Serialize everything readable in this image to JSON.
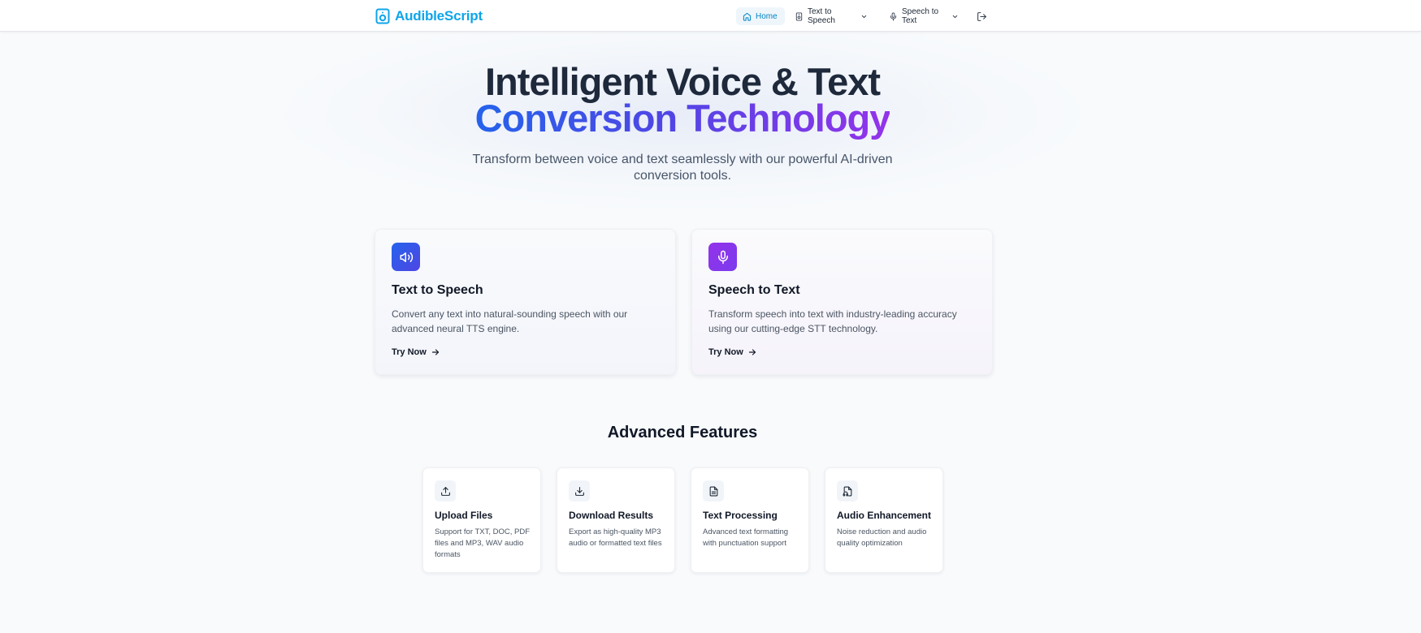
{
  "brand": {
    "name": "AudibleScript"
  },
  "nav": {
    "home": "Home",
    "text_to_speech": "Text to Speech",
    "speech_to_text": "Speech to Text"
  },
  "hero": {
    "title_line1": "Intelligent Voice & Text",
    "title_line2": "Conversion Technology",
    "subtitle": "Transform between voice and text seamlessly with our powerful AI-driven conversion tools."
  },
  "services": [
    {
      "title": "Text to Speech",
      "description": "Convert any text into natural-sounding speech with our advanced neural TTS engine.",
      "cta": "Try Now",
      "icon": "speaker-icon",
      "accent": "#2563eb"
    },
    {
      "title": "Speech to Text",
      "description": "Transform speech into text with industry-leading accuracy using our cutting-edge STT technology.",
      "cta": "Try Now",
      "icon": "microphone-icon",
      "accent": "#9333ea"
    }
  ],
  "features": {
    "heading": "Advanced Features",
    "items": [
      {
        "title": "Upload Files",
        "description": "Support for TXT, DOC, PDF files and MP3, WAV audio formats",
        "icon": "upload-icon"
      },
      {
        "title": "Download Results",
        "description": "Export as high-quality MP3 audio or formatted text files",
        "icon": "download-icon"
      },
      {
        "title": "Text Processing",
        "description": "Advanced text formatting with punctuation support",
        "icon": "document-icon"
      },
      {
        "title": "Audio Enhancement",
        "description": "Noise reduction and audio quality optimization",
        "icon": "audio-file-icon"
      }
    ]
  },
  "colors": {
    "brand": "#0ea5e9",
    "gradient_start": "#2563eb",
    "gradient_end": "#9333ea",
    "background": "#f8fafc"
  }
}
